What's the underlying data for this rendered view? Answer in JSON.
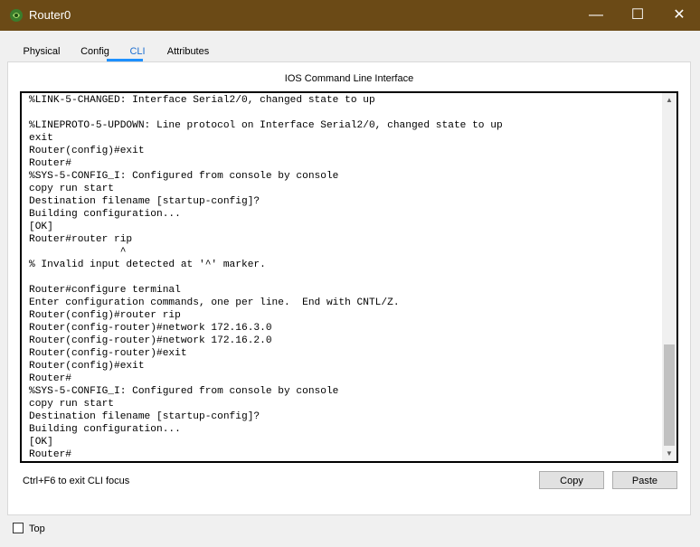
{
  "window": {
    "title": "Router0",
    "minimize_label": "—",
    "maximize_label": "☐",
    "close_label": "✕"
  },
  "tabs": [
    {
      "label": "Physical"
    },
    {
      "label": "Config"
    },
    {
      "label": "CLI",
      "active": true
    },
    {
      "label": "Attributes"
    }
  ],
  "panel": {
    "title": "IOS Command Line Interface"
  },
  "cli": {
    "content": "%LINK-5-CHANGED: Interface Serial2/0, changed state to up\n\n%LINEPROTO-5-UPDOWN: Line protocol on Interface Serial2/0, changed state to up\nexit\nRouter(config)#exit\nRouter#\n%SYS-5-CONFIG_I: Configured from console by console\ncopy run start\nDestination filename [startup-config]?\nBuilding configuration...\n[OK]\nRouter#router rip\n               ^\n% Invalid input detected at '^' marker.\n\nRouter#configure terminal\nEnter configuration commands, one per line.  End with CNTL/Z.\nRouter(config)#router rip\nRouter(config-router)#network 172.16.3.0\nRouter(config-router)#network 172.16.2.0\nRouter(config-router)#exit\nRouter(config)#exit\nRouter#\n%SYS-5-CONFIG_I: Configured from console by console\ncopy run start\nDestination filename [startup-config]?\nBuilding configuration...\n[OK]\nRouter#"
  },
  "footer": {
    "hint": "Ctrl+F6 to exit CLI focus",
    "copy_label": "Copy",
    "paste_label": "Paste"
  },
  "bottom": {
    "top_label": "Top",
    "top_checked": false
  },
  "colors": {
    "titlebar": "#6b4a16",
    "tab_active": "#1e90ff"
  }
}
